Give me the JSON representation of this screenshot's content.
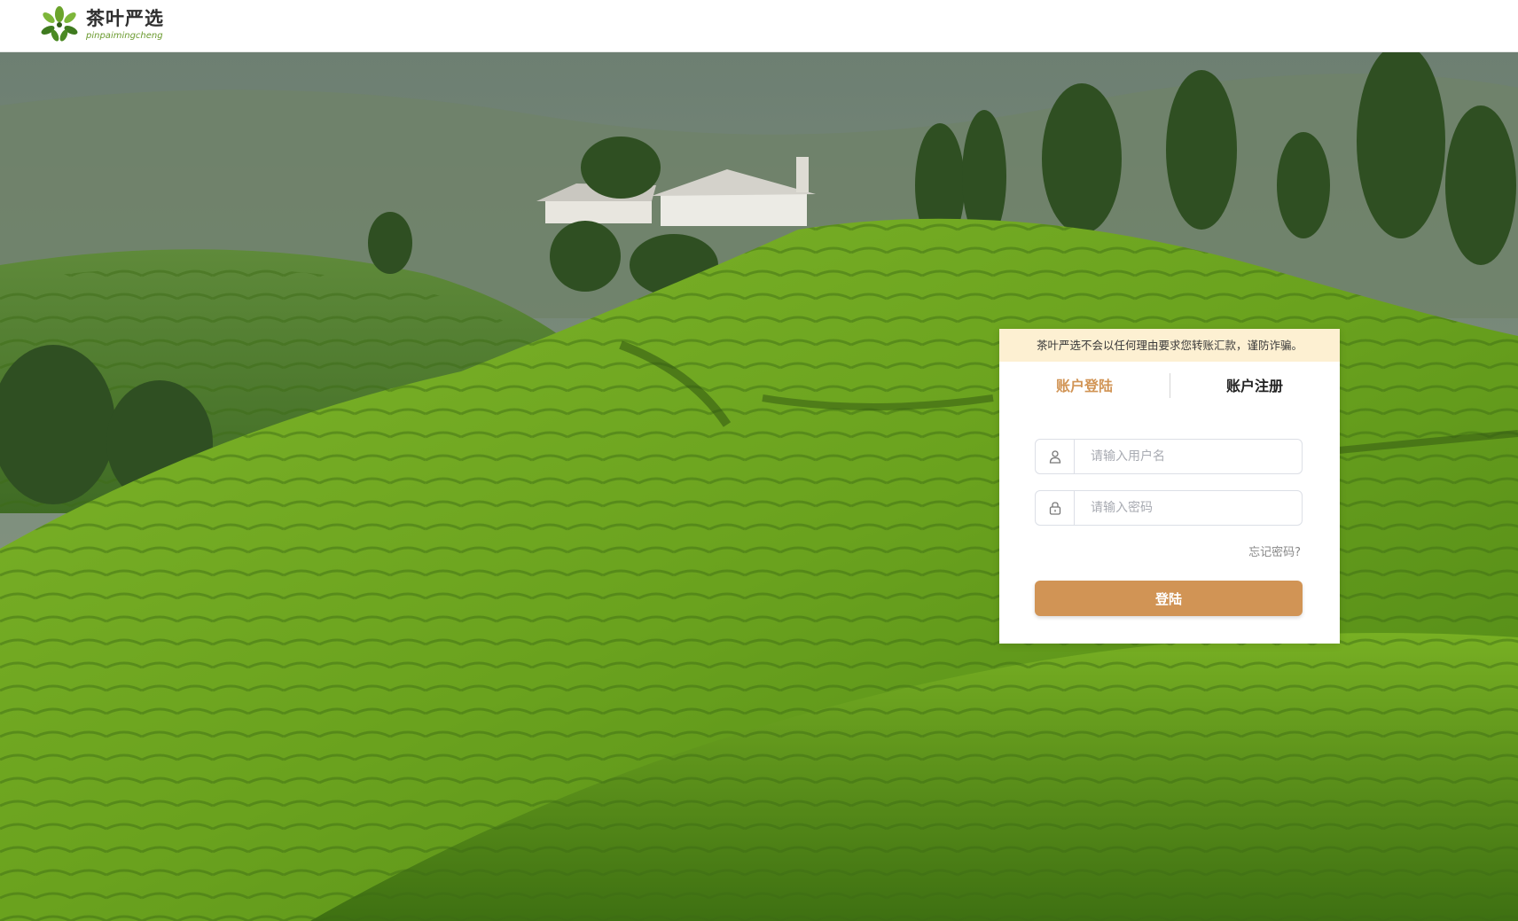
{
  "header": {
    "logo_title": "茶叶严选",
    "logo_subtitle": "pinpaimingcheng"
  },
  "login_card": {
    "notice": "茶叶严选不会以任何理由要求您转账汇款，谨防诈骗。",
    "tabs": [
      {
        "label": "账户登陆",
        "active": true
      },
      {
        "label": "账户注册",
        "active": false
      }
    ],
    "username_placeholder": "请输入用户名",
    "password_placeholder": "请输入密码",
    "forgot_label": "忘记密码?",
    "submit_label": "登陆",
    "icons": {
      "username": "user-icon",
      "password": "lock-icon"
    },
    "accent_color": "#d19455"
  },
  "background": {
    "subject": "tea-plantation-hills"
  }
}
